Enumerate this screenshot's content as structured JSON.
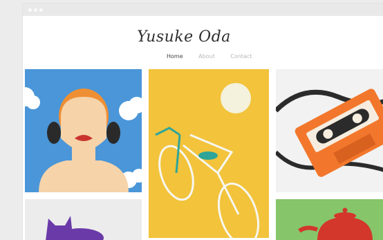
{
  "site": {
    "title": "Yusuke Oda",
    "nav": [
      {
        "label": "Home",
        "active": true
      },
      {
        "label": "About",
        "active": false
      },
      {
        "label": "Contact",
        "active": false
      }
    ]
  },
  "colors": {
    "portrait_bg": "#4a96d8",
    "bike_bg": "#f2c33b",
    "cassette": "#f2772c",
    "cat_purple": "#6a3aa8",
    "teapot_red": "#d3362b",
    "kettle_bg": "#86c56a"
  },
  "gallery": [
    {
      "icon": "portrait-illustration"
    },
    {
      "icon": "bicycle-illustration"
    },
    {
      "icon": "cassette-tape-illustration"
    },
    {
      "icon": "cat-illustration"
    },
    {
      "icon": "teapot-illustration"
    }
  ]
}
